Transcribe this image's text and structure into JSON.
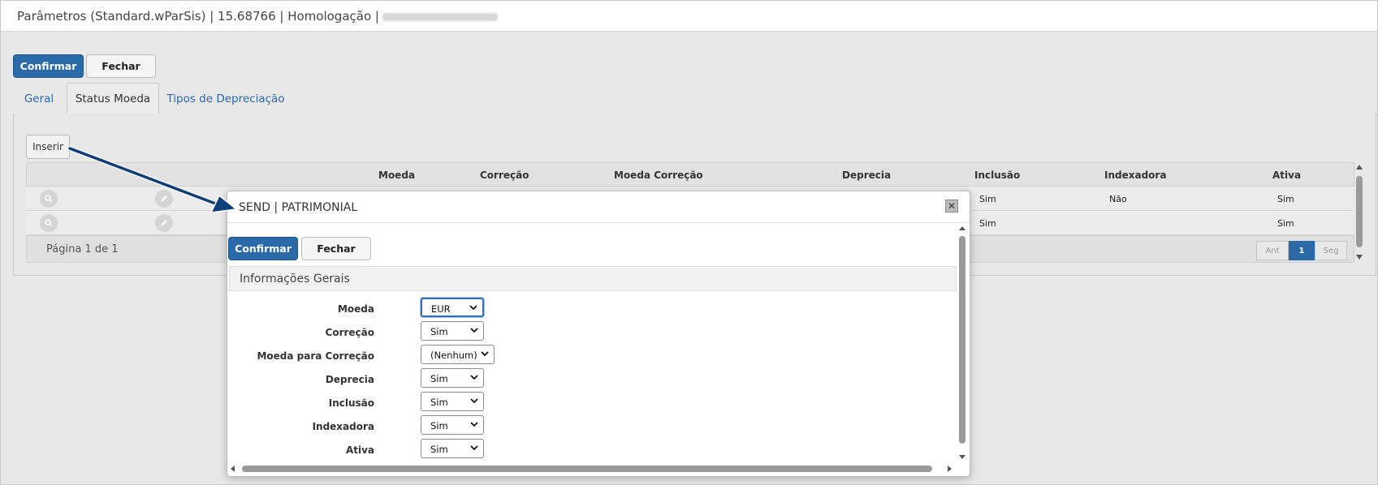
{
  "window": {
    "title": "Parâmetros (Standard.wParSis) | 15.68766 | Homologação |"
  },
  "toolbar": {
    "confirm_label": "Confirmar",
    "close_label": "Fechar"
  },
  "tabs": [
    {
      "label": "Geral",
      "active": false
    },
    {
      "label": "Status Moeda",
      "active": true
    },
    {
      "label": "Tipos de Depreciação",
      "active": false
    }
  ],
  "grid": {
    "insert_label": "Inserir",
    "columns": [
      "Moeda",
      "Correção",
      "Moeda Correção",
      "Deprecia",
      "Inclusão",
      "Indexadora",
      "Ativa"
    ],
    "rows": [
      {
        "inclusao": "Sim",
        "indexadora": "Não",
        "ativa": "Sim"
      },
      {
        "inclusao": "Sim",
        "indexadora": "",
        "ativa": "Sim"
      }
    ],
    "pager": {
      "label": "Página 1 de 1",
      "prev": "Ant",
      "current": "1",
      "next": "Seg"
    }
  },
  "dialog": {
    "title": "SEND | PATRIMONIAL",
    "confirm_label": "Confirmar",
    "close_label": "Fechar",
    "section_title": "Informações Gerais",
    "fields": [
      {
        "label": "Moeda",
        "value": "EUR"
      },
      {
        "label": "Correção",
        "value": "Sim"
      },
      {
        "label": "Moeda para Correção",
        "value": "(Nenhum)"
      },
      {
        "label": "Deprecia",
        "value": "Sim"
      },
      {
        "label": "Inclusão",
        "value": "Sim"
      },
      {
        "label": "Indexadora",
        "value": "Sim"
      },
      {
        "label": "Ativa",
        "value": "Sim"
      }
    ]
  },
  "colors": {
    "primary": "#2a6aa8",
    "arrow": "#0f3e78",
    "background": "#e8e8e8"
  },
  "icons": [
    "search-icon",
    "edit-icon",
    "close-icon",
    "chevron-down-icon",
    "scroll-up-icon",
    "scroll-down-icon",
    "scroll-left-icon",
    "scroll-right-icon"
  ]
}
